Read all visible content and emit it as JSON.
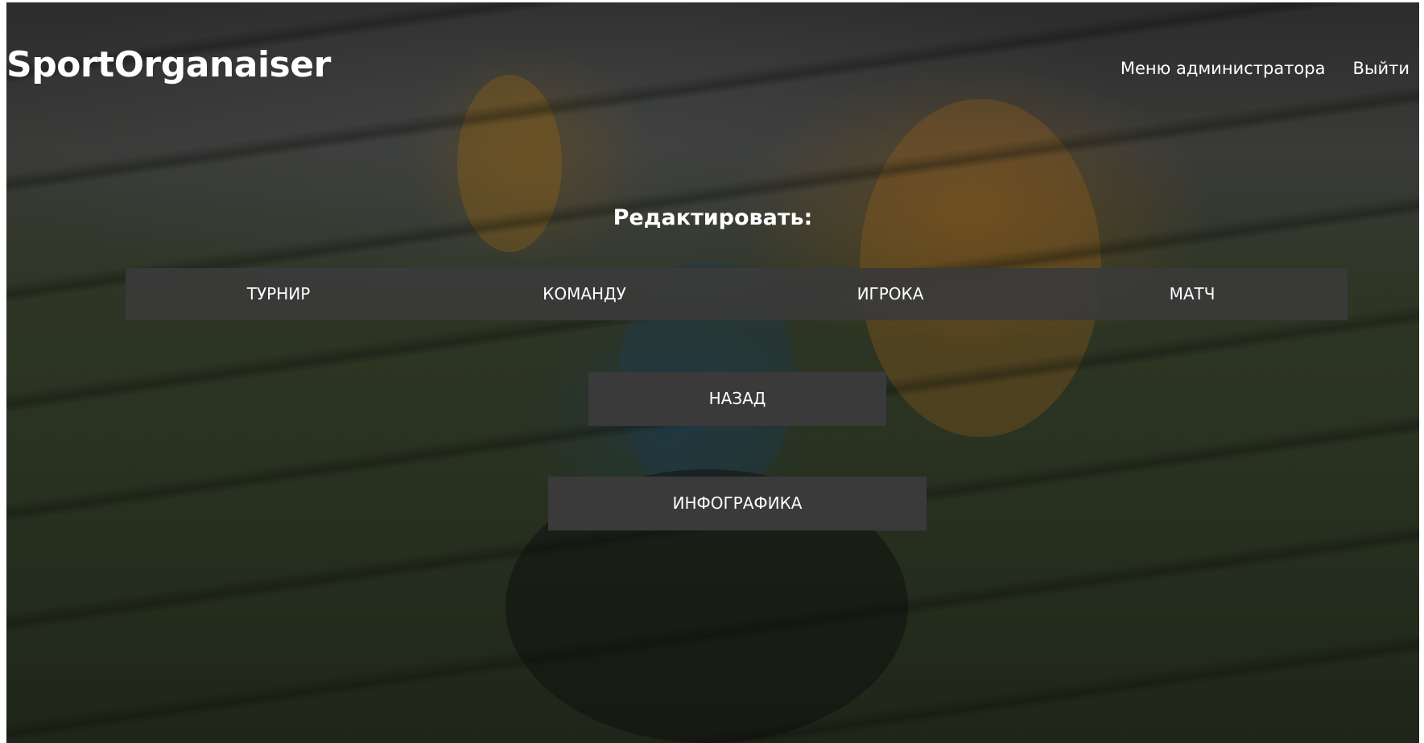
{
  "header": {
    "logo": "SportOrganaiser",
    "nav": {
      "admin_menu": "Меню администратора",
      "logout": "Выйти"
    }
  },
  "edit": {
    "heading": "Редактировать:",
    "items": [
      {
        "label": "ТУРНИР"
      },
      {
        "label": "КОМАНДУ"
      },
      {
        "label": "ИГРОКА"
      },
      {
        "label": "МАТЧ"
      }
    ]
  },
  "actions": {
    "back": "НАЗАД",
    "infographics": "ИНФОГРАФИКА"
  }
}
